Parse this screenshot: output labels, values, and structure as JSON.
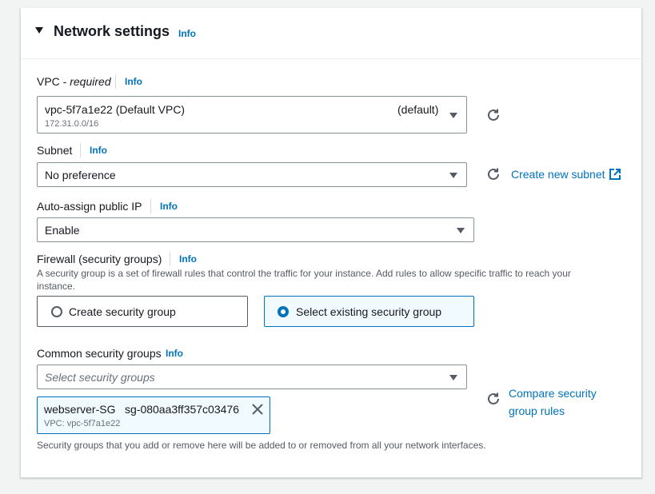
{
  "section": {
    "title": "Network settings",
    "info": "Info"
  },
  "vpc": {
    "label": "VPC - ",
    "required": "required",
    "info": "Info",
    "value": "vpc-5f7a1e22 (Default VPC)",
    "tag": "(default)",
    "cidr": "172.31.0.0/16"
  },
  "subnet": {
    "label": "Subnet",
    "info": "Info",
    "value": "No preference",
    "create_link": "Create new subnet"
  },
  "public_ip": {
    "label": "Auto-assign public IP",
    "info": "Info",
    "value": "Enable"
  },
  "firewall": {
    "label": "Firewall (security groups)",
    "info": "Info",
    "description_line1": "A security group is a set of firewall rules that control the traffic for your instance. Add rules to allow specific traffic to reach your",
    "description_line2": "instance.",
    "options": [
      {
        "label": "Create security group",
        "selected": false
      },
      {
        "label": "Select existing security group",
        "selected": true
      }
    ]
  },
  "common_sg": {
    "label": "Common security groups",
    "info": "Info",
    "placeholder": "Select security groups",
    "compare_link_line1": "Compare security",
    "compare_link_line2": "group rules",
    "selected": [
      {
        "name": "webserver-SG",
        "id": "sg-080aa3ff357c03476",
        "vpc": "VPC: vpc-5f7a1e22"
      }
    ],
    "help": "Security groups that you add or remove here will be added to or removed from all your network interfaces."
  },
  "colors": {
    "link": "#0073bb",
    "border": "#879596",
    "selected_bg": "#f1faff"
  },
  "icons": {
    "refresh": "refresh-icon",
    "external": "external-link-icon",
    "caret": "caret-down-icon",
    "dismiss": "close-icon"
  }
}
